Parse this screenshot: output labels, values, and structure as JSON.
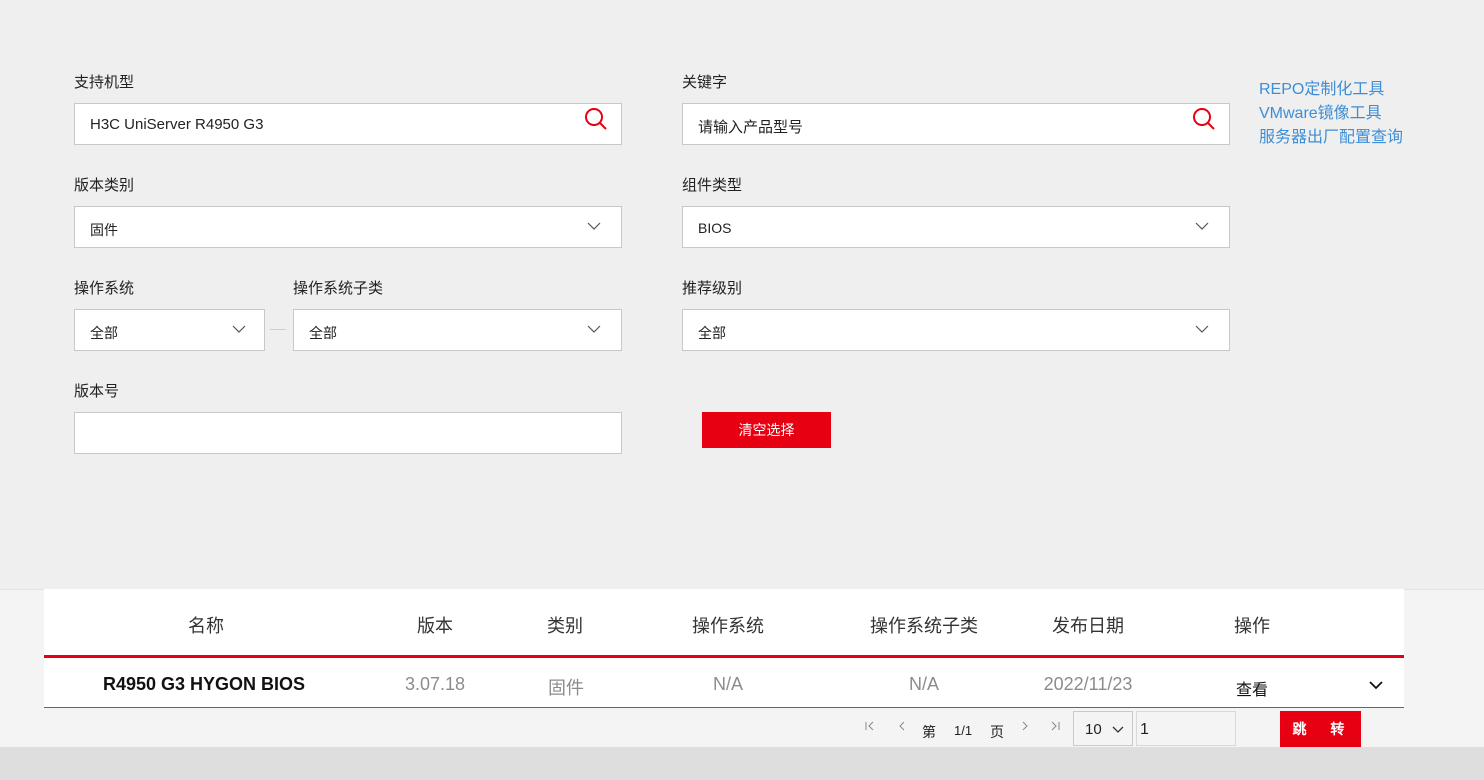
{
  "filters": {
    "model": {
      "label": "支持机型",
      "value": "H3C UniServer R4950 G3"
    },
    "keyword": {
      "label": "关键字",
      "placeholder": "请输入产品型号"
    },
    "version_category": {
      "label": "版本类别",
      "value": "固件"
    },
    "component_type": {
      "label": "组件类型",
      "value": "BIOS"
    },
    "os": {
      "label": "操作系统",
      "value": "全部"
    },
    "os_subcategory": {
      "label": "操作系统子类",
      "value": "全部"
    },
    "recommend_level": {
      "label": "推荐级别",
      "value": "全部"
    },
    "version_no": {
      "label": "版本号",
      "value": ""
    },
    "clear_label": "清空选择"
  },
  "side_links": [
    "REPO定制化工具",
    "VMware镜像工具",
    "服务器出厂配置查询"
  ],
  "table": {
    "headers": [
      "名称",
      "版本",
      "类别",
      "操作系统",
      "操作系统子类",
      "发布日期",
      "操作"
    ],
    "rows": [
      {
        "name": "R4950 G3 HYGON BIOS",
        "version": "3.07.18",
        "category": "固件",
        "os": "N/A",
        "os_sub": "N/A",
        "date": "2022/11/23",
        "action": "查看"
      }
    ]
  },
  "pager": {
    "page_prefix": "第",
    "page_info": "1/1",
    "page_suffix": "页",
    "page_size": "10",
    "jump_value": "1",
    "jump_label": "跳 转"
  },
  "colors": {
    "accent": "#e60012",
    "link": "#3d8ed6"
  },
  "icons": [
    "search-icon",
    "chevron-down-icon",
    "first-page-icon",
    "prev-page-icon",
    "next-page-icon",
    "last-page-icon"
  ]
}
